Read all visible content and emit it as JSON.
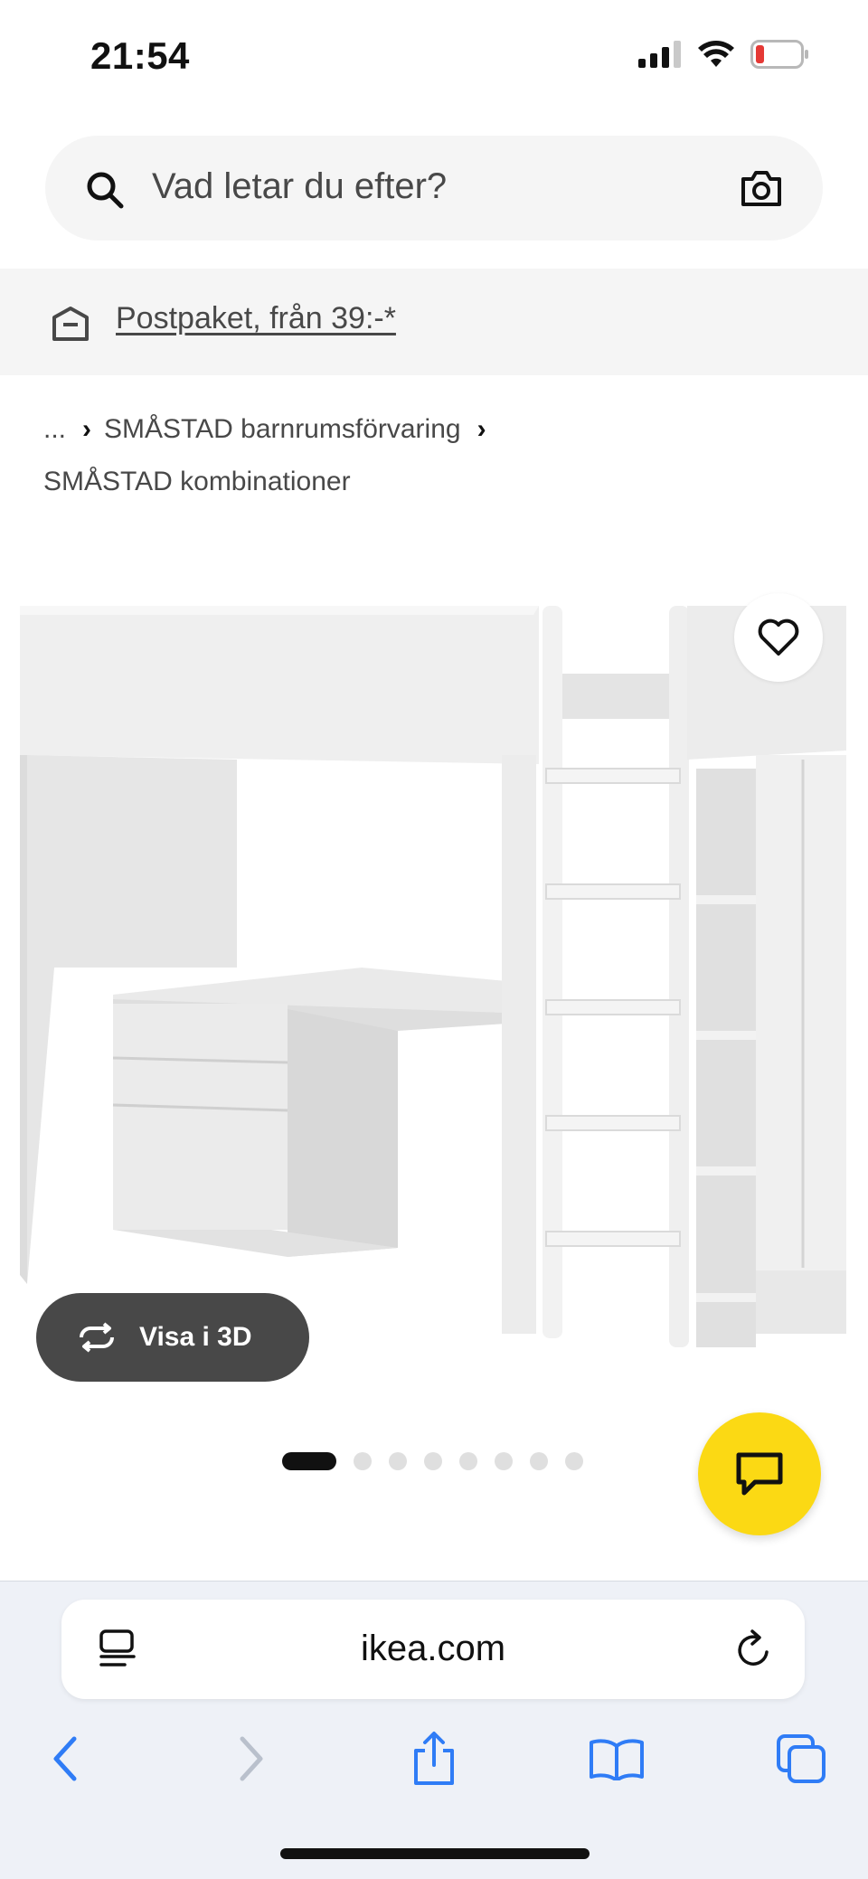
{
  "status_bar": {
    "time": "21:54",
    "battery_color": "#e53935"
  },
  "search": {
    "placeholder": "Vad letar du efter?"
  },
  "banner": {
    "link_text": "Postpaket, från 39:-*"
  },
  "breadcrumb": {
    "ellipsis": "...",
    "items": [
      "SMÅSTAD barnrumsförvaring",
      "SMÅSTAD kombinationer"
    ]
  },
  "product": {
    "view3d_label": "Visa i 3D",
    "image_count": 8,
    "active_image": 1
  },
  "browser": {
    "url": "ikea.com"
  },
  "colors": {
    "accent_yellow": "#fbd914",
    "dark_button": "#484848",
    "ios_blue": "#2f7cf6"
  }
}
